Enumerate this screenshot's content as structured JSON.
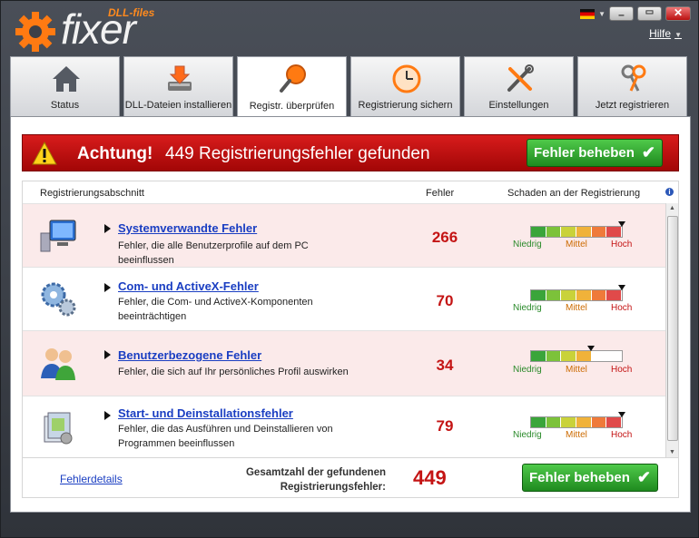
{
  "app": {
    "brand": "fixer",
    "brand_sub": "DLL-files",
    "help": "Hilfe"
  },
  "tabs": [
    {
      "label": "Status",
      "icon": "home-icon"
    },
    {
      "label": "DLL-Dateien installieren",
      "icon": "install-icon"
    },
    {
      "label": "Registr. überprüfen",
      "icon": "magnifier-icon",
      "active": true
    },
    {
      "label": "Registrierung sichern",
      "icon": "clock-backup-icon"
    },
    {
      "label": "Einstellungen",
      "icon": "tools-icon"
    },
    {
      "label": "Jetzt registrieren",
      "icon": "keys-icon"
    }
  ],
  "banner": {
    "attention": "Achtung!",
    "message": "449 Registrierungsfehler gefunden",
    "fix_button": "Fehler beheben"
  },
  "table": {
    "headers": {
      "section": "Registrierungsabschnitt",
      "errors": "Fehler",
      "damage": "Schaden an der Registrierung"
    },
    "rows": [
      {
        "title": "Systemverwandte Fehler",
        "desc": "Fehler, die alle Benutzerprofile auf dem PC beeinflussen",
        "count": "266",
        "level": 1.0
      },
      {
        "title": "Com- und ActiveX-Fehler",
        "desc": "Fehler, die Com- und ActiveX-Komponenten beeinträchtigen",
        "count": "70",
        "level": 1.0
      },
      {
        "title": "Benutzerbezogene Fehler",
        "desc": "Fehler, die sich auf Ihr persönliches Profil auswirken",
        "count": "34",
        "level": 0.6
      },
      {
        "title": "Start- und Deinstallationsfehler",
        "desc": "Fehler, die das Ausführen und Deinstallieren von Programmen beeinflussen",
        "count": "79",
        "level": 1.0
      }
    ],
    "meter_labels": {
      "low": "Niedrig",
      "mid": "Mittel",
      "high": "Hoch"
    }
  },
  "footer": {
    "details_link": "Fehlerdetails",
    "total_label": "Gesamtzahl der gefundenen Registrierungsfehler:",
    "total_count": "449",
    "fix_button": "Fehler beheben"
  },
  "colors": {
    "accent_red": "#c41414",
    "fix_green": "#2aa02a",
    "link_blue": "#1a3ec2"
  }
}
